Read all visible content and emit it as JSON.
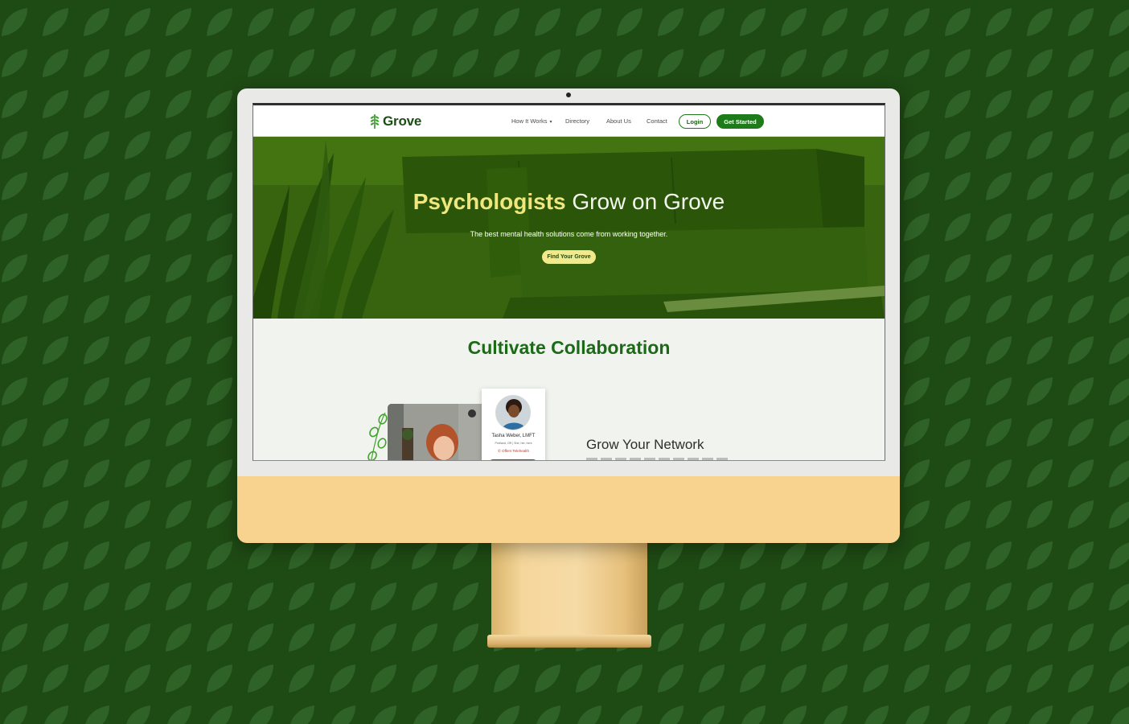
{
  "nav": {
    "logo_text": "Grove",
    "items": [
      {
        "label": "How It Works",
        "dropdown": true
      },
      {
        "label": "Directory"
      },
      {
        "label": "About Us"
      },
      {
        "label": "Contact"
      }
    ],
    "login_label": "Login",
    "get_started_label": "Get Started"
  },
  "hero": {
    "title_accent": "Psychologists",
    "title_rest": " Grow on Grove",
    "subtitle": "The best mental health solutions come from working together.",
    "cta_label": "Find Your Grove"
  },
  "collab": {
    "title": "Cultivate Collaboration",
    "profile": {
      "name": "Tasha Weber, LMFT",
      "meta": "Portland, OR | She, her, hers",
      "telehealth": "Offers Telehealth"
    },
    "network_title": "Grow Your Network"
  },
  "colors": {
    "brand_green": "#1f7a1a",
    "dark_green": "#1e4a14",
    "accent_yellow": "#f0e67e",
    "imac_chin": "#f8d28f"
  },
  "icons": {
    "logo": "sprout-logo-icon",
    "nav_caret": "chevron-down-icon",
    "telehealth": "phone-icon"
  }
}
